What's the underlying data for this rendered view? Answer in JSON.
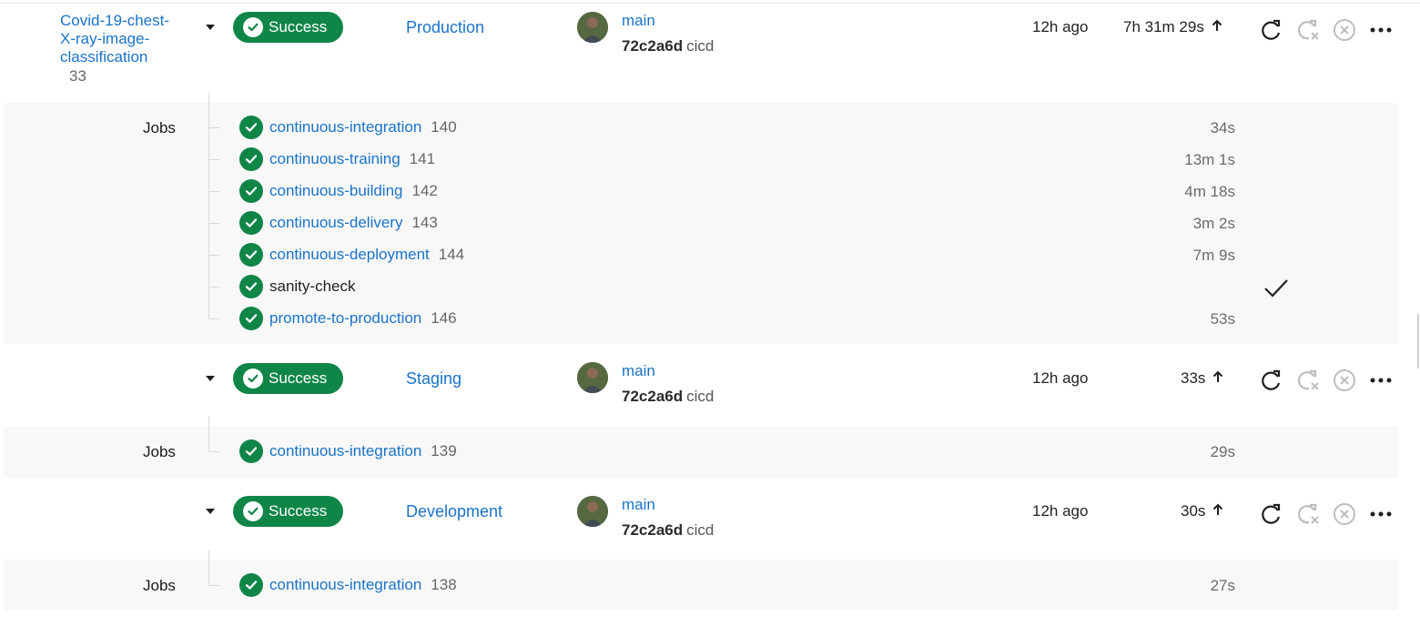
{
  "project": {
    "name_line1": "Covid-19-chest-",
    "name_line2": "X-ray-image-",
    "name_line3": "classification",
    "id": "33"
  },
  "deployments": [
    {
      "status": "Success",
      "environment": "Production",
      "branch": "main",
      "sha": "72c2a6d",
      "tag": "cicd",
      "created": "12h ago",
      "duration": "7h 31m 29s",
      "jobs_label": "Jobs",
      "jobs": [
        {
          "name": "continuous-integration",
          "id": "140",
          "duration": "34s",
          "link": true
        },
        {
          "name": "continuous-training",
          "id": "141",
          "duration": "13m 1s",
          "link": true
        },
        {
          "name": "continuous-building",
          "id": "142",
          "duration": "4m 18s",
          "link": true
        },
        {
          "name": "continuous-delivery",
          "id": "143",
          "duration": "3m 2s",
          "link": true
        },
        {
          "name": "continuous-deployment",
          "id": "144",
          "duration": "7m 9s",
          "link": true
        },
        {
          "name": "sanity-check",
          "id": "",
          "duration": "",
          "link": false
        },
        {
          "name": "promote-to-production",
          "id": "146",
          "duration": "53s",
          "link": true
        }
      ]
    },
    {
      "status": "Success",
      "environment": "Staging",
      "branch": "main",
      "sha": "72c2a6d",
      "tag": "cicd",
      "created": "12h ago",
      "duration": "33s",
      "jobs_label": "Jobs",
      "jobs": [
        {
          "name": "continuous-integration",
          "id": "139",
          "duration": "29s",
          "link": true
        }
      ]
    },
    {
      "status": "Success",
      "environment": "Development",
      "branch": "main",
      "sha": "72c2a6d",
      "tag": "cicd",
      "created": "12h ago",
      "duration": "30s",
      "jobs_label": "Jobs",
      "jobs": [
        {
          "name": "continuous-integration",
          "id": "138",
          "duration": "27s",
          "link": true
        }
      ]
    }
  ],
  "colors": {
    "success": "#108548",
    "link": "#1a73c8"
  },
  "icons": [
    "check-circle-icon",
    "chevron-down-icon",
    "retry-icon",
    "rollback-icon",
    "cancel-icon",
    "more-icon",
    "arrow-up-icon",
    "checkmark-icon"
  ]
}
